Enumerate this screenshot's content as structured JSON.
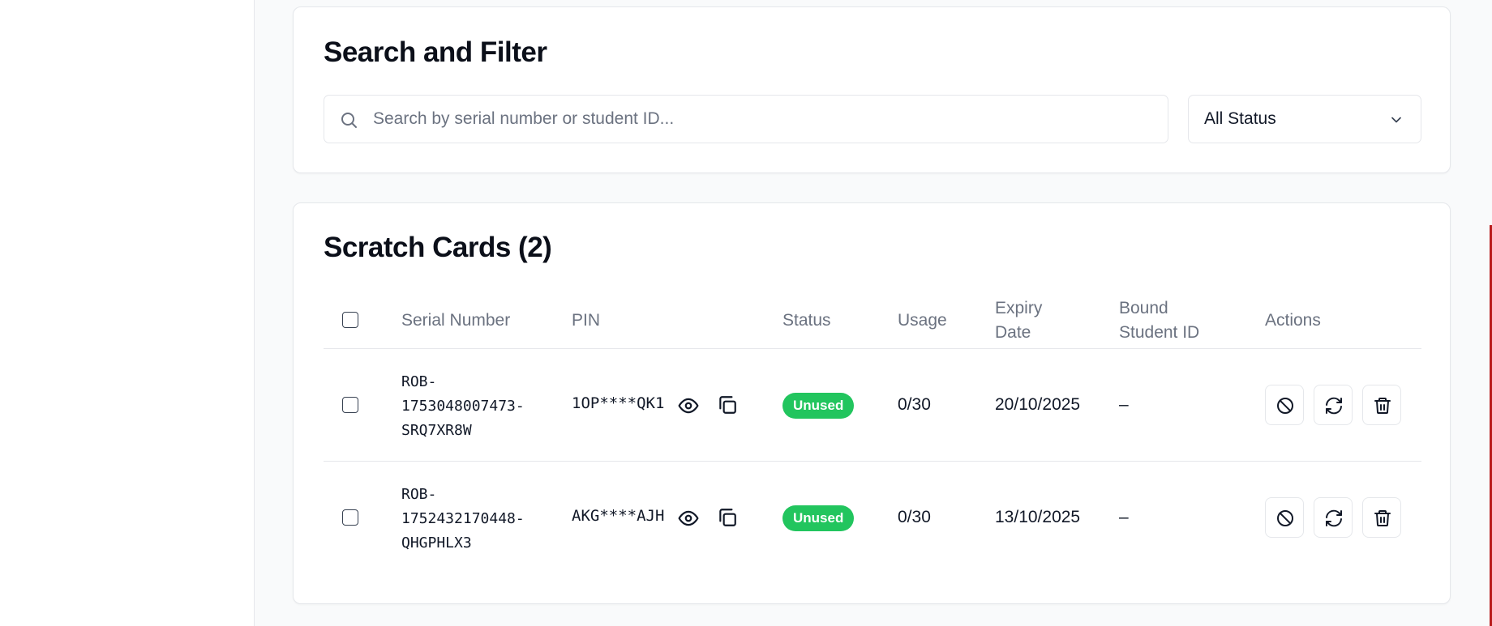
{
  "search_filter": {
    "title": "Search and Filter",
    "search_placeholder": "Search by serial number or student ID...",
    "status_value": "All Status"
  },
  "cards": {
    "title": "Scratch Cards (2)",
    "columns": {
      "serial": "Serial Number",
      "pin": "PIN",
      "status": "Status",
      "usage": "Usage",
      "expiry_line1": "Expiry",
      "expiry_line2": "Date",
      "bound_line1": "Bound",
      "bound_line2": "Student ID",
      "actions": "Actions"
    },
    "rows": [
      {
        "serial_parts": [
          "ROB-",
          "1753048007473-",
          "SRQ7XR8W"
        ],
        "pin": "1OP****QK1",
        "status": "Unused",
        "usage": "0/30",
        "expiry": "20/10/2025",
        "bound": "–"
      },
      {
        "serial_parts": [
          "ROB-",
          "1752432170448-",
          "QHGPHLX3"
        ],
        "pin": "AKG****AJH",
        "status": "Unused",
        "usage": "0/30",
        "expiry": "13/10/2025",
        "bound": "–"
      }
    ]
  },
  "colors": {
    "status_unused": "#22c55e",
    "edge_accent": "#b91c1c"
  },
  "icons": {
    "search": "search-icon",
    "select": "chevron-down-icon",
    "reveal": "eye-icon",
    "copy": "copy-icon",
    "disable": "ban-icon",
    "regenerate": "refresh-icon",
    "delete": "trash-icon"
  }
}
